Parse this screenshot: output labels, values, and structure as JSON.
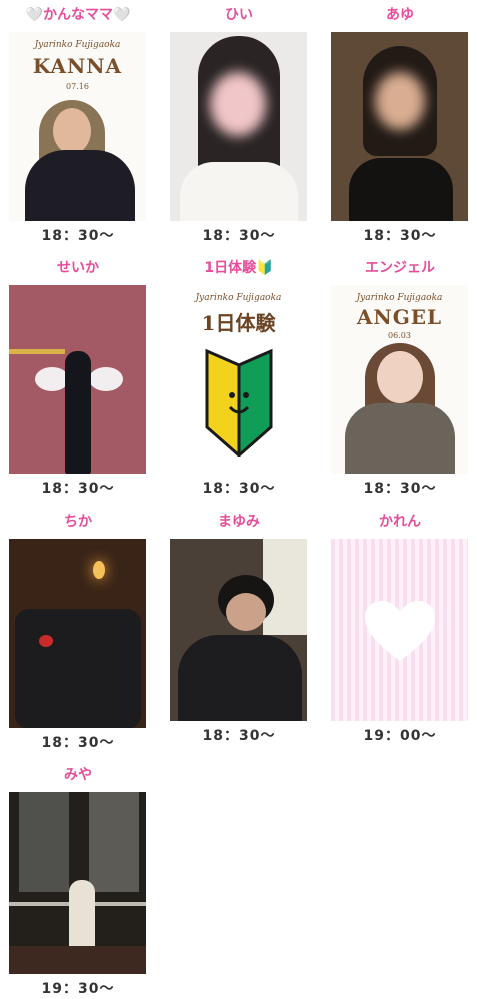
{
  "cards": [
    {
      "name": "🤍かんなママ🤍",
      "time": "18：30〜",
      "logo": "Jyarinko Fujigaoka",
      "banner": "KANNA",
      "date": "07.16"
    },
    {
      "name": "ひい",
      "time": "18：30〜"
    },
    {
      "name": "あゆ",
      "time": "18：30〜"
    },
    {
      "name": "せいか",
      "time": "18：30〜"
    },
    {
      "name": "1日体験🔰",
      "time": "18：30〜",
      "logo": "Jyarinko Fujigaoka",
      "banner": "1日体験"
    },
    {
      "name": "エンジェル",
      "time": "18：30〜",
      "logo": "Jyarinko Fujigaoka",
      "banner": "ANGEL",
      "date": "06.03"
    },
    {
      "name": "ちか",
      "time": "18：30〜"
    },
    {
      "name": "まゆみ",
      "time": "18：30〜"
    },
    {
      "name": "かれん",
      "time": "19：00〜"
    },
    {
      "name": "みや",
      "time": "19：30〜"
    }
  ],
  "colors": {
    "name": "#e64d9a",
    "time": "#333333",
    "brand": "#7a4f2a",
    "beginner_yellow": "#f2d21c",
    "beginner_green": "#0f9d58"
  }
}
